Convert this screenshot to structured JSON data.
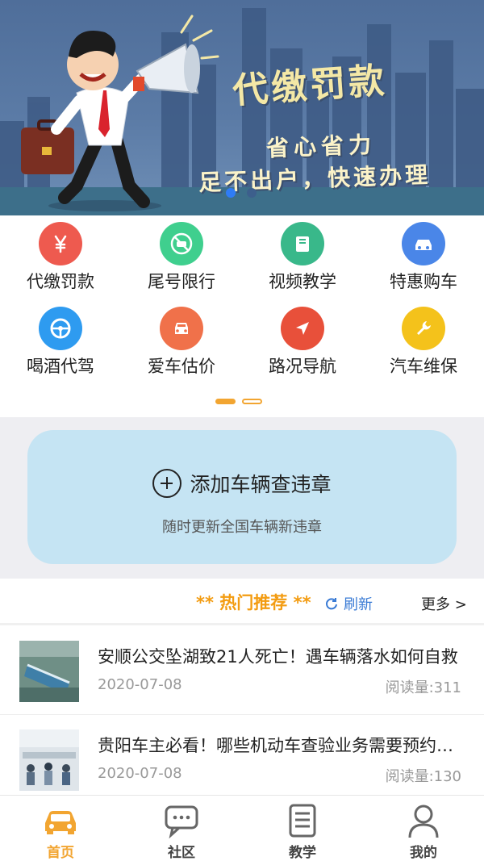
{
  "banner": {
    "title": "代缴罚款",
    "subtitle_line1": "省心省力",
    "subtitle_line2": "足不出户，快速办理",
    "slide_count": 2,
    "active_slide": 1
  },
  "services": [
    {
      "label": "代缴罚款",
      "icon": "yen-icon",
      "color": "#ee5a4f"
    },
    {
      "label": "尾号限行",
      "icon": "no-car-icon",
      "color": "#3fcf8e"
    },
    {
      "label": "视频教学",
      "icon": "book-icon",
      "color": "#39b88a"
    },
    {
      "label": "特惠购车",
      "icon": "car-icon",
      "color": "#4a86e8"
    },
    {
      "label": "喝酒代驾",
      "icon": "steering-wheel-icon",
      "color": "#2e9bf0"
    },
    {
      "label": "爱车估价",
      "icon": "car-front-icon",
      "color": "#f0714a"
    },
    {
      "label": "路况导航",
      "icon": "navigation-arrow-icon",
      "color": "#e8503a"
    },
    {
      "label": "汽车维保",
      "icon": "wrench-icon",
      "color": "#f4c21b"
    }
  ],
  "add_vehicle": {
    "title": "添加车辆查违章",
    "subtitle": "随时更新全国车辆新违章"
  },
  "hot": {
    "title": "** 热门推荐 **",
    "refresh_label": "刷新",
    "more_label": "更多 >"
  },
  "news": [
    {
      "title": "安顺公交坠湖致21人死亡！遇车辆落水如何自救",
      "date": "2020-07-08",
      "reads": "阅读量:311"
    },
    {
      "title": "贵阳车主必看！哪些机动车查验业务需要预约办理",
      "date": "2020-07-08",
      "reads": "阅读量:130"
    }
  ],
  "tabs": [
    {
      "label": "首页",
      "icon": "car-icon",
      "active": true
    },
    {
      "label": "社区",
      "icon": "chat-bubble-icon",
      "active": false
    },
    {
      "label": "教学",
      "icon": "document-icon",
      "active": false
    },
    {
      "label": "我的",
      "icon": "user-icon",
      "active": false
    }
  ],
  "colors": {
    "accent": "#f2a531",
    "link": "#3a7bd5",
    "card_bg": "#c5e4f3"
  }
}
